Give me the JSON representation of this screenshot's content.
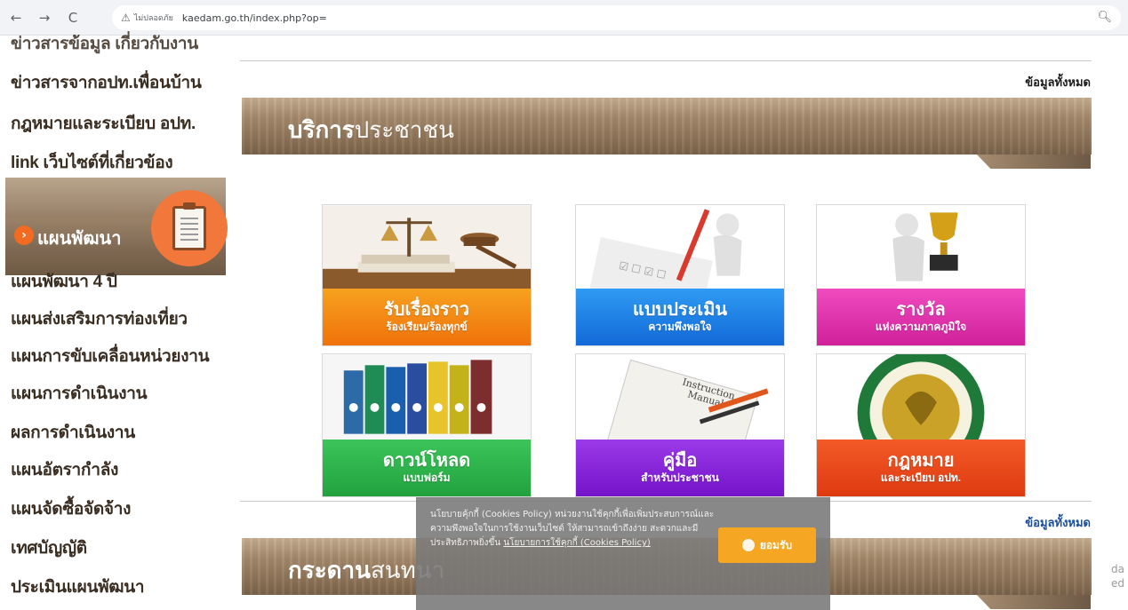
{
  "browser": {
    "back": "←",
    "forward": "→",
    "reload": "C",
    "security_icon": "warning-icon",
    "security_label": "ไม่ปลอดภัย",
    "url": "kaedam.go.th/index.php?op=",
    "zoom_icon": "zoom-icon"
  },
  "sidebar": {
    "items_top": [
      "ข่าวสารข้อมูล เกี่ยวกับงาน",
      "ข่าวสารจากอปท.เพื่อนบ้าน",
      "กฎหมายและระเบียบ อปท.",
      "link เว็บไซต์ที่เกี่ยวข้อง"
    ],
    "banner_label": "แผนพัฒนา",
    "banner_arrow": "›",
    "items_bottom": [
      "แผนพัฒนา 4 ปี",
      "แผนส่งเสริมการท่องเที่ยว",
      "แผนการขับเคลื่อนหน่วยงาน",
      "แผนการดำเนินงาน",
      "ผลการดำเนินงาน",
      "แผนอัตรากำลัง",
      "แผนจัดซื้อจัดจ้าง",
      "เทศบัญญัติ",
      "ประเมินแผนพัฒนา"
    ]
  },
  "main": {
    "all_label_1": "ข้อมูลทั้งหมด",
    "section1_bold": "บริการ",
    "section1_rest": "ประชาชน",
    "tiles": [
      {
        "title": "รับเรื่องราว",
        "subtitle": "ร้องเรียน/ร้องทุกข์",
        "color": "#f28a12",
        "icon": "justice-scale-icon"
      },
      {
        "title": "แบบประเมิน",
        "subtitle": "ความพึงพอใจ",
        "color": "#1c86e8",
        "icon": "assessment-pen-icon"
      },
      {
        "title": "รางวัล",
        "subtitle": "แห่งความภาคภูมิใจ",
        "color": "#e23aa9",
        "icon": "trophy-icon"
      },
      {
        "title": "ดาวน์โหลด",
        "subtitle": "แบบฟอร์ม",
        "color": "#2fb24a",
        "icon": "binders-icon"
      },
      {
        "title": "คู่มือ",
        "subtitle": "สำหรับประชาชน",
        "color": "#8a27d6",
        "icon": "manual-icon"
      },
      {
        "title": "กฎหมาย",
        "subtitle": "และระเบียบ อปท.",
        "color": "#ee4a1c",
        "icon": "emblem-icon"
      }
    ],
    "all_label_2": "ข้อมูลทั้งหมด",
    "section2_bold": "กระดาน",
    "section2_rest": "สนทนา"
  },
  "cookie": {
    "text": "นโยบายคุ้กกี้ (Cookies Policy) หน่วยงานใช้คุกกี้เพื่อเพิ่มประสบการณ์และความพึงพอใจในการใช้งานเว็บไซต์ ให้สามารถเข้าถึงง่าย สะดวกและมีประสิทธิภาพยิ่งขึ้น",
    "link": "นโยบายการใช้คุกกี้ (Cookies Policy)",
    "accept": "ยอมรับ"
  },
  "corner": {
    "line1": "da",
    "line2": "ed"
  }
}
